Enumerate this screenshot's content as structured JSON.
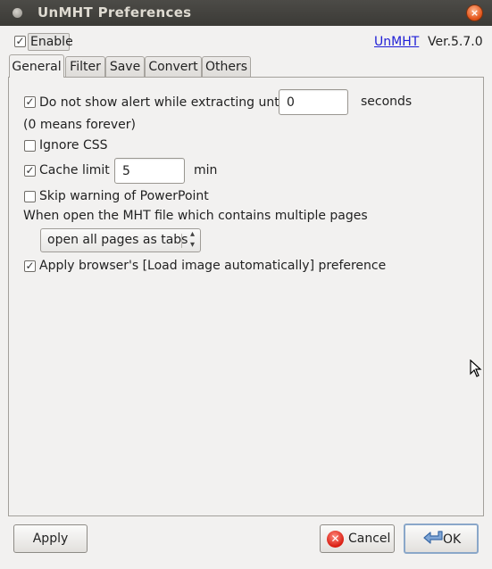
{
  "window": {
    "title": "UnMHT Preferences"
  },
  "header": {
    "enable_label": "Enable",
    "enable_checked": true,
    "link_text": "UnMHT",
    "version": "Ver.5.7.0"
  },
  "tabs": [
    {
      "label": "General",
      "active": true
    },
    {
      "label": "Filter",
      "active": false
    },
    {
      "label": "Save",
      "active": false
    },
    {
      "label": "Convert",
      "active": false
    },
    {
      "label": "Others",
      "active": false
    }
  ],
  "general": {
    "alert_label": "Do not show alert while extracting until",
    "alert_checked": true,
    "alert_value": "0",
    "alert_unit": "seconds",
    "alert_note": "(0 means forever)",
    "ignore_css_label": "Ignore CSS",
    "ignore_css_checked": false,
    "cache_limit_label": "Cache limit",
    "cache_limit_checked": true,
    "cache_limit_value": "5",
    "cache_limit_unit": "min",
    "skip_ppt_label": "Skip warning of PowerPoint",
    "skip_ppt_checked": false,
    "multi_pages_label": "When open the MHT file which contains multiple pages",
    "multi_pages_selected": "open all pages as tabs",
    "load_image_label": "Apply browser's [Load image automatically] preference",
    "load_image_checked": true
  },
  "buttons": {
    "apply": "Apply",
    "cancel": "Cancel",
    "ok": "OK"
  }
}
